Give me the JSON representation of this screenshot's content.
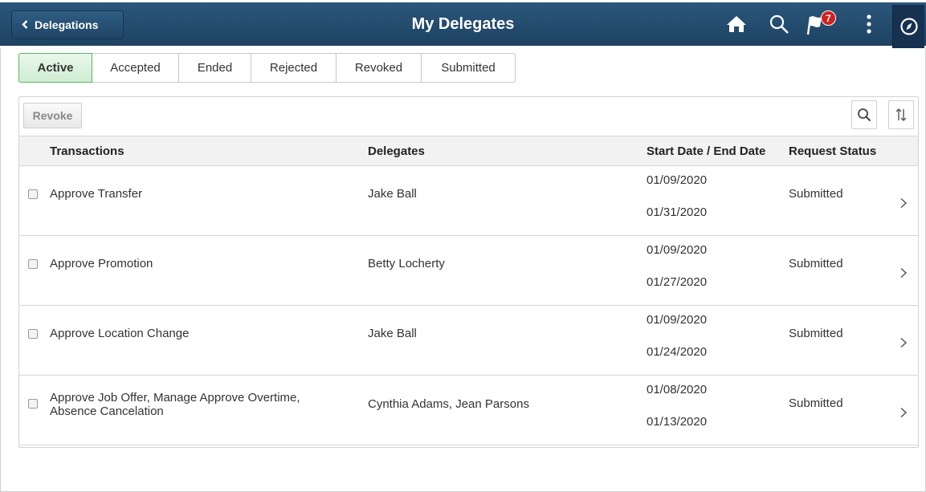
{
  "header": {
    "back_label": "Delegations",
    "title": "My Delegates",
    "notification_count": "7",
    "colors": {
      "banner": "#1e4262",
      "badge": "#d32020"
    }
  },
  "tabs": [
    {
      "label": "Active",
      "selected": true
    },
    {
      "label": "Accepted",
      "selected": false
    },
    {
      "label": "Ended",
      "selected": false
    },
    {
      "label": "Rejected",
      "selected": false
    },
    {
      "label": "Revoked",
      "selected": false
    },
    {
      "label": "Submitted",
      "selected": false
    }
  ],
  "toolbar": {
    "revoke_label": "Revoke"
  },
  "columns": {
    "transactions": "Transactions",
    "delegates": "Delegates",
    "dates": "Start Date / End Date",
    "status": "Request Status"
  },
  "rows": [
    {
      "transaction": "Approve Transfer",
      "delegates": "Jake Ball",
      "start": "01/09/2020",
      "end": "01/31/2020",
      "status": "Submitted"
    },
    {
      "transaction": "Approve Promotion",
      "delegates": "Betty Locherty",
      "start": "01/09/2020",
      "end": "01/27/2020",
      "status": "Submitted"
    },
    {
      "transaction": "Approve Location Change",
      "delegates": "Jake Ball",
      "start": "01/09/2020",
      "end": "01/24/2020",
      "status": "Submitted"
    },
    {
      "transaction": "Approve Job Offer, Manage Approve Overtime, Absence Cancelation",
      "delegates": "Cynthia Adams, Jean Parsons",
      "start": "01/08/2020",
      "end": "01/13/2020",
      "status": "Submitted"
    }
  ]
}
